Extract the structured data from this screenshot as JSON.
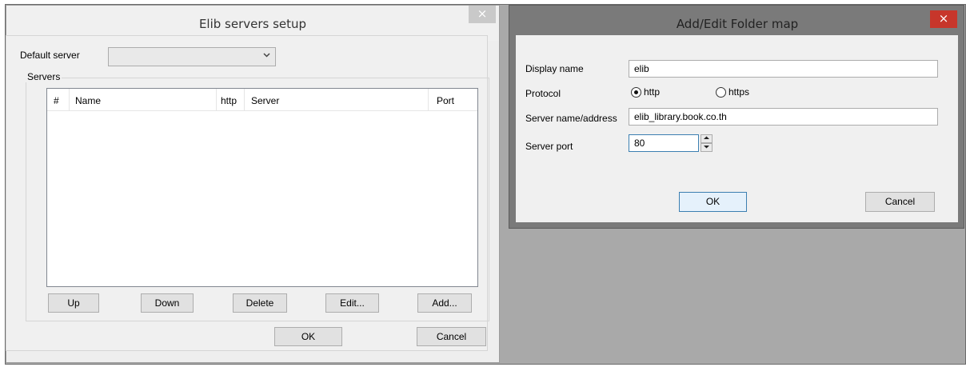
{
  "servers_window": {
    "title": "Elib servers setup",
    "close_glyph": "×",
    "default_server_label": "Default server",
    "default_server_value": "",
    "servers_group_label": "Servers",
    "columns": [
      "#",
      "Name",
      "http",
      "Server",
      "Port"
    ],
    "rows": [],
    "buttons": {
      "up": "Up",
      "down": "Down",
      "delete": "Delete",
      "edit": "Edit...",
      "add": "Add..."
    },
    "ok": "OK",
    "cancel": "Cancel"
  },
  "folder_map_dialog": {
    "title": "Add/Edit Folder map",
    "close_glyph": "×",
    "display_name_label": "Display name",
    "display_name_value": "elib",
    "protocol_label": "Protocol",
    "protocol_options": [
      "http",
      "https"
    ],
    "protocol_selected": "http",
    "server_label": "Server name/address",
    "server_value": "elib_library.book.co.th",
    "port_label": "Server port",
    "port_value": "80",
    "ok": "OK",
    "cancel": "Cancel"
  },
  "icons": {
    "dropdown": "chevron-down-icon",
    "spin_up": "arrow-up-icon",
    "spin_down": "arrow-down-icon"
  },
  "colors": {
    "close_active": "#c7362b",
    "close_inactive": "#c9c9c9",
    "focus_border": "#3c7fb1",
    "backdrop": "#a9a9a9"
  }
}
